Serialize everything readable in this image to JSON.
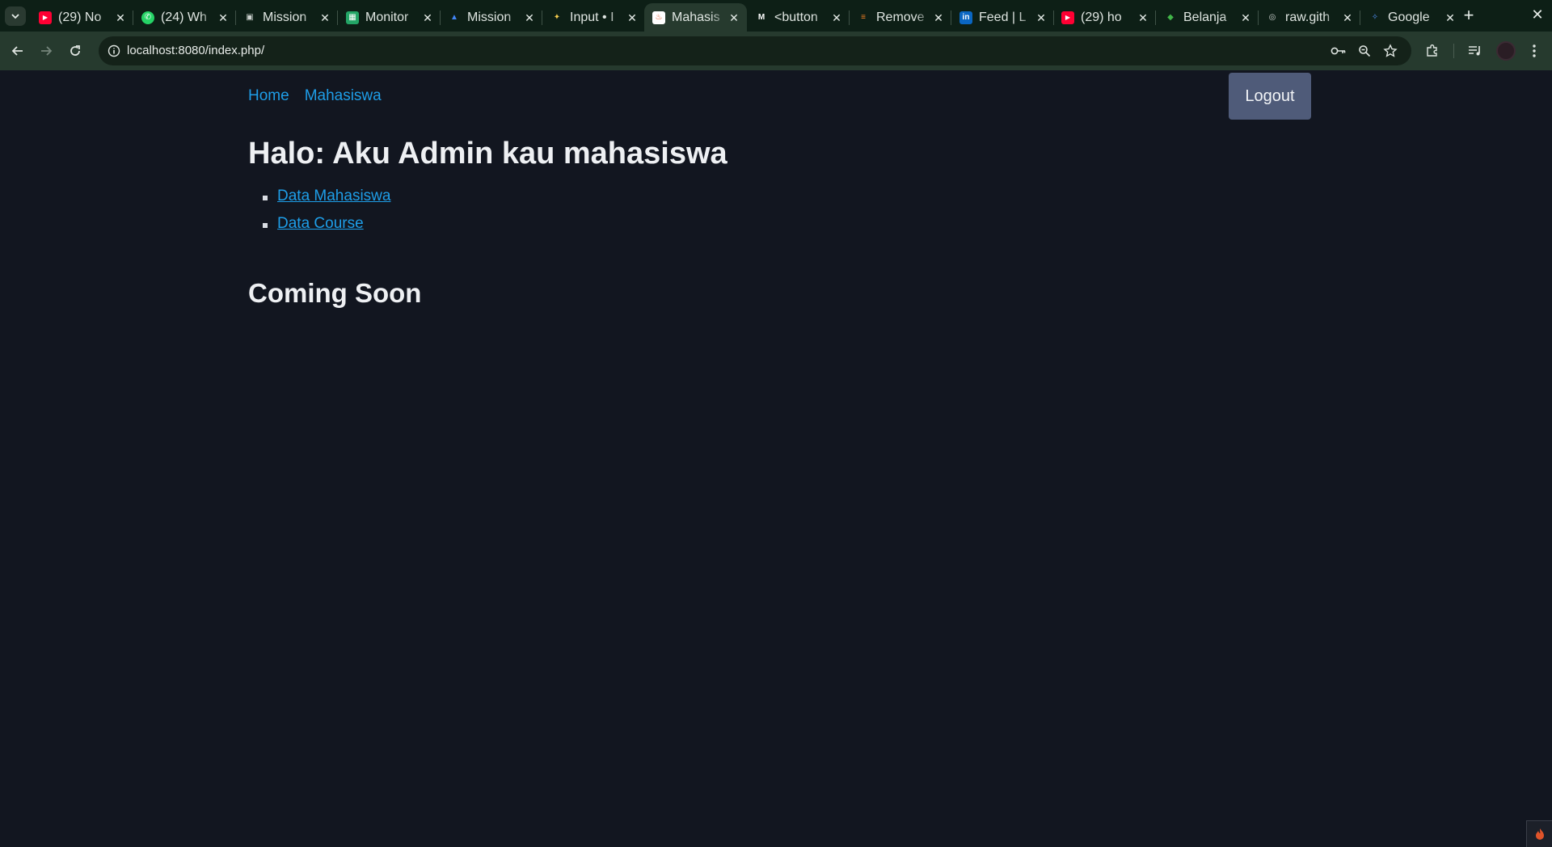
{
  "browser": {
    "tabs": [
      {
        "title": "(29) No",
        "icon": "youtube-icon",
        "color": "#ff0033"
      },
      {
        "title": "(24) Wh",
        "icon": "whatsapp-icon",
        "color": "#25d366"
      },
      {
        "title": "Mission",
        "icon": "profile-page-icon",
        "color": "#cfd4d1"
      },
      {
        "title": "Monitor",
        "icon": "sheets-icon",
        "color": "#23a566"
      },
      {
        "title": "Mission",
        "icon": "drive-icon",
        "color": "#4285f4"
      },
      {
        "title": "Input • I",
        "icon": "sparkle-icon",
        "color": "#f2c94c"
      },
      {
        "title": "Mahasis",
        "icon": "codeigniter-icon",
        "color": "#dd4814",
        "active": true
      },
      {
        "title": "<button",
        "icon": "mdn-icon",
        "color": "#ffffff"
      },
      {
        "title": "Remove",
        "icon": "stackoverflow-icon",
        "color": "#f48024"
      },
      {
        "title": "Feed | L",
        "icon": "linkedin-icon",
        "color": "#0a66c2"
      },
      {
        "title": "(29) ho",
        "icon": "youtube-icon",
        "color": "#ff0033"
      },
      {
        "title": "Belanja",
        "icon": "tokopedia-icon",
        "color": "#42b549"
      },
      {
        "title": "raw.gith",
        "icon": "globe-icon",
        "color": "#cfd4d1"
      },
      {
        "title": "Google",
        "icon": "gemini-icon",
        "color": "#4e8cf0"
      }
    ],
    "url": "localhost:8080/index.php/"
  },
  "page": {
    "nav": {
      "home": "Home",
      "mahasiswa": "Mahasiswa"
    },
    "logout_label": "Logout",
    "heading": "Halo: Aku Admin kau mahasiswa",
    "links": [
      "Data Mahasiswa",
      "Data Course"
    ],
    "subheading": "Coming Soon"
  },
  "colors": {
    "page_bg": "#121620",
    "link": "#1e9ee8",
    "logout_bg": "#4f5b79",
    "chrome_bg": "#263a2e"
  }
}
